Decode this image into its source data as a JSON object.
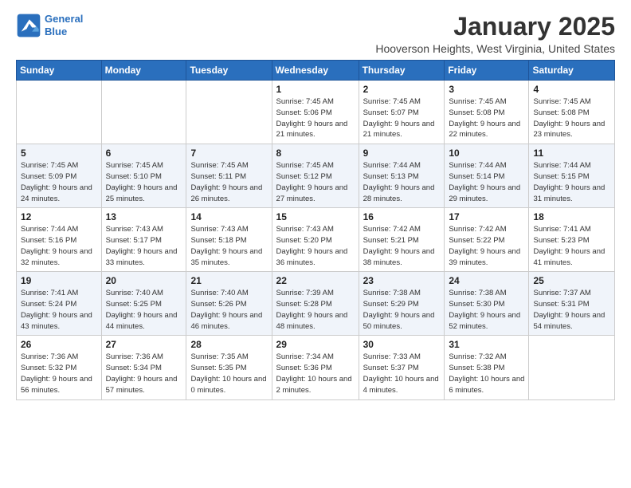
{
  "logo": {
    "line1": "General",
    "line2": "Blue"
  },
  "title": "January 2025",
  "location": "Hooverson Heights, West Virginia, United States",
  "weekdays": [
    "Sunday",
    "Monday",
    "Tuesday",
    "Wednesday",
    "Thursday",
    "Friday",
    "Saturday"
  ],
  "weeks": [
    [
      {
        "day": "",
        "info": ""
      },
      {
        "day": "",
        "info": ""
      },
      {
        "day": "",
        "info": ""
      },
      {
        "day": "1",
        "info": "Sunrise: 7:45 AM\nSunset: 5:06 PM\nDaylight: 9 hours and 21 minutes."
      },
      {
        "day": "2",
        "info": "Sunrise: 7:45 AM\nSunset: 5:07 PM\nDaylight: 9 hours and 21 minutes."
      },
      {
        "day": "3",
        "info": "Sunrise: 7:45 AM\nSunset: 5:08 PM\nDaylight: 9 hours and 22 minutes."
      },
      {
        "day": "4",
        "info": "Sunrise: 7:45 AM\nSunset: 5:08 PM\nDaylight: 9 hours and 23 minutes."
      }
    ],
    [
      {
        "day": "5",
        "info": "Sunrise: 7:45 AM\nSunset: 5:09 PM\nDaylight: 9 hours and 24 minutes."
      },
      {
        "day": "6",
        "info": "Sunrise: 7:45 AM\nSunset: 5:10 PM\nDaylight: 9 hours and 25 minutes."
      },
      {
        "day": "7",
        "info": "Sunrise: 7:45 AM\nSunset: 5:11 PM\nDaylight: 9 hours and 26 minutes."
      },
      {
        "day": "8",
        "info": "Sunrise: 7:45 AM\nSunset: 5:12 PM\nDaylight: 9 hours and 27 minutes."
      },
      {
        "day": "9",
        "info": "Sunrise: 7:44 AM\nSunset: 5:13 PM\nDaylight: 9 hours and 28 minutes."
      },
      {
        "day": "10",
        "info": "Sunrise: 7:44 AM\nSunset: 5:14 PM\nDaylight: 9 hours and 29 minutes."
      },
      {
        "day": "11",
        "info": "Sunrise: 7:44 AM\nSunset: 5:15 PM\nDaylight: 9 hours and 31 minutes."
      }
    ],
    [
      {
        "day": "12",
        "info": "Sunrise: 7:44 AM\nSunset: 5:16 PM\nDaylight: 9 hours and 32 minutes."
      },
      {
        "day": "13",
        "info": "Sunrise: 7:43 AM\nSunset: 5:17 PM\nDaylight: 9 hours and 33 minutes."
      },
      {
        "day": "14",
        "info": "Sunrise: 7:43 AM\nSunset: 5:18 PM\nDaylight: 9 hours and 35 minutes."
      },
      {
        "day": "15",
        "info": "Sunrise: 7:43 AM\nSunset: 5:20 PM\nDaylight: 9 hours and 36 minutes."
      },
      {
        "day": "16",
        "info": "Sunrise: 7:42 AM\nSunset: 5:21 PM\nDaylight: 9 hours and 38 minutes."
      },
      {
        "day": "17",
        "info": "Sunrise: 7:42 AM\nSunset: 5:22 PM\nDaylight: 9 hours and 39 minutes."
      },
      {
        "day": "18",
        "info": "Sunrise: 7:41 AM\nSunset: 5:23 PM\nDaylight: 9 hours and 41 minutes."
      }
    ],
    [
      {
        "day": "19",
        "info": "Sunrise: 7:41 AM\nSunset: 5:24 PM\nDaylight: 9 hours and 43 minutes."
      },
      {
        "day": "20",
        "info": "Sunrise: 7:40 AM\nSunset: 5:25 PM\nDaylight: 9 hours and 44 minutes."
      },
      {
        "day": "21",
        "info": "Sunrise: 7:40 AM\nSunset: 5:26 PM\nDaylight: 9 hours and 46 minutes."
      },
      {
        "day": "22",
        "info": "Sunrise: 7:39 AM\nSunset: 5:28 PM\nDaylight: 9 hours and 48 minutes."
      },
      {
        "day": "23",
        "info": "Sunrise: 7:38 AM\nSunset: 5:29 PM\nDaylight: 9 hours and 50 minutes."
      },
      {
        "day": "24",
        "info": "Sunrise: 7:38 AM\nSunset: 5:30 PM\nDaylight: 9 hours and 52 minutes."
      },
      {
        "day": "25",
        "info": "Sunrise: 7:37 AM\nSunset: 5:31 PM\nDaylight: 9 hours and 54 minutes."
      }
    ],
    [
      {
        "day": "26",
        "info": "Sunrise: 7:36 AM\nSunset: 5:32 PM\nDaylight: 9 hours and 56 minutes."
      },
      {
        "day": "27",
        "info": "Sunrise: 7:36 AM\nSunset: 5:34 PM\nDaylight: 9 hours and 57 minutes."
      },
      {
        "day": "28",
        "info": "Sunrise: 7:35 AM\nSunset: 5:35 PM\nDaylight: 10 hours and 0 minutes."
      },
      {
        "day": "29",
        "info": "Sunrise: 7:34 AM\nSunset: 5:36 PM\nDaylight: 10 hours and 2 minutes."
      },
      {
        "day": "30",
        "info": "Sunrise: 7:33 AM\nSunset: 5:37 PM\nDaylight: 10 hours and 4 minutes."
      },
      {
        "day": "31",
        "info": "Sunrise: 7:32 AM\nSunset: 5:38 PM\nDaylight: 10 hours and 6 minutes."
      },
      {
        "day": "",
        "info": ""
      }
    ]
  ]
}
